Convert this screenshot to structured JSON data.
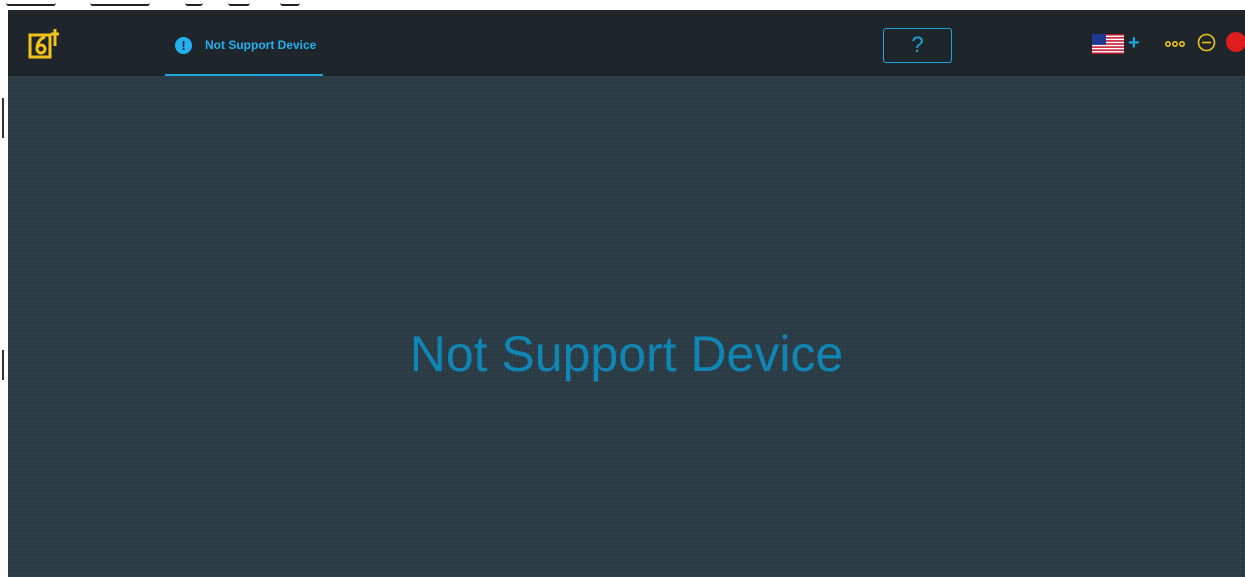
{
  "window": {
    "tab_label": "Not Support Device",
    "tab_icon_glyph": "!"
  },
  "toolbar": {
    "help_label": "?",
    "add_language_label": "+",
    "language_flag": "us-flag-icon"
  },
  "main": {
    "message": "Not Support Device"
  },
  "colors": {
    "background": "#2b3b45",
    "titlebar": "#1e252b",
    "accent": "#1aa7e0",
    "message_text": "#0f86b4",
    "logo_yellow": "#f2c41b",
    "close_red": "#e01d1d"
  }
}
